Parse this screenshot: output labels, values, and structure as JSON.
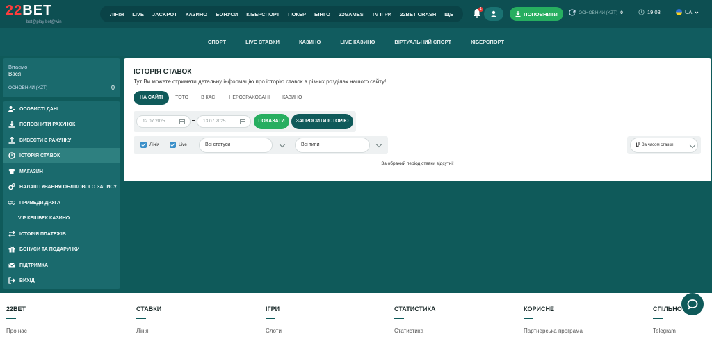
{
  "header": {
    "logo_main": "22BET",
    "logo_sub": "bet@play bet@win",
    "nav": [
      "ЛІНІЯ",
      "LIVE",
      "JACKPOT",
      "КАЗИНО",
      "БОНУСИ",
      "КІБЕРСПОРТ",
      "ПОКЕР",
      "БІНГО",
      "22GAMES",
      "TV ІГРИ",
      "22BET CRASH",
      "ЩЕ"
    ],
    "notif_count": "1",
    "deposit_label": "ПОПОВНИТИ",
    "balance_label": "ОСНОВНИЙ (KZT)",
    "balance_value": "0",
    "time": "19:03",
    "lang": "UA"
  },
  "subnav": [
    "СПОРТ",
    "LIVE СТАВКИ",
    "КАЗИНО",
    "LIVE КАЗИНО",
    "ВІРТУАЛЬНИЙ СПОРТ",
    "КІБЕРСПОРТ"
  ],
  "sidebar": {
    "greeting": "Вітаємо",
    "username": "Вася",
    "account_label": "ОСНОВНИЙ (KZT)",
    "account_value": "0",
    "items": [
      {
        "label": "ОСОБИСТІ ДАНІ",
        "icon": "user-card-icon"
      },
      {
        "label": "ПОПОВНИТИ РАХУНОК",
        "icon": "download-icon"
      },
      {
        "label": "ВИВЕСТИ З РАХУНКУ",
        "icon": "upload-icon"
      },
      {
        "label": "ІСТОРІЯ СТАВОК",
        "icon": "clock-icon"
      },
      {
        "label": "МАГАЗИН",
        "icon": "shirt-icon"
      },
      {
        "label": "НАЛАШТУВАННЯ ОБЛІКОВОГО ЗАПИСУ",
        "icon": "gears-icon"
      },
      {
        "label": "ПРИВЕДИ ДРУГА",
        "icon": "handshake-icon"
      },
      {
        "label": "VIP КЕШБЕК КАЗИНО",
        "icon": ""
      },
      {
        "label": "ІСТОРІЯ ПЛАТЕЖІВ",
        "icon": "arrows-icon"
      },
      {
        "label": "БОНУСИ ТА ПОДАРУНКИ",
        "icon": "gift-icon"
      },
      {
        "label": "ПІДТРИМКА",
        "icon": "mail-icon"
      },
      {
        "label": "ВИХІД",
        "icon": "logout-icon"
      }
    ],
    "active_index": 3
  },
  "main": {
    "title": "ІСТОРІЯ СТАВОК",
    "description": "Тут Ви можете отримати детальну інформацію про історію ставок в різних розділах нашого сайту!",
    "tabs": [
      "НА САЙТІ",
      "ТОТО",
      "В КАСІ",
      "НЕРОЗРАХОВАНІ",
      "КАЗИНО"
    ],
    "date_from": "12.07.2025",
    "date_to": "13.07.2025",
    "show_btn": "ПОКАЗАТИ",
    "request_btn": "ЗАПРОСИТИ ІСТОРІЮ",
    "check_line": "Лінія",
    "check_live": "Live",
    "status_select": "Всі статуси",
    "type_select": "Всі типи",
    "sort_select": "За часом ставки",
    "empty_message": "За обраний період ставки відсутні!"
  },
  "footer": {
    "columns": [
      {
        "title": "22BET",
        "item": "Про нас"
      },
      {
        "title": "СТАВКИ",
        "item": "Лінія"
      },
      {
        "title": "ІГРИ",
        "item": "Слоти"
      },
      {
        "title": "СТАТИСТИКА",
        "item": "Статистика"
      },
      {
        "title": "КОРИСНЕ",
        "item": "Партнерська програма"
      },
      {
        "title": "СПІЛЬНОТА",
        "item": "Telegram"
      }
    ]
  },
  "colors": {
    "primary": "#0f5a5a",
    "accent_green": "#27ae60",
    "logo_red": "#ff3d3d"
  }
}
